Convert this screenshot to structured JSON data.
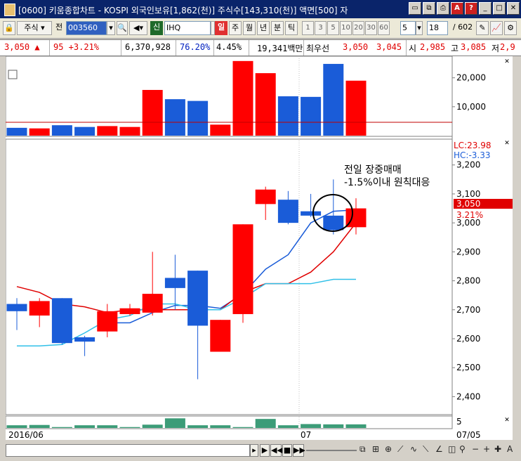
{
  "window": {
    "title": "[0600] 키움종합차트 - KOSPI 외국인보유[1,862(천)] 주식수[143,310(천)] 액면[500] 자",
    "icons": [
      "minimize-icon",
      "maximize-icon",
      "close-icon"
    ]
  },
  "toolbar": {
    "market_select": "주식",
    "code_prefix": "전",
    "stock_code": "003560",
    "stock_name": "IHQ",
    "credit_label": "신",
    "periods": [
      "일",
      "주",
      "월",
      "년",
      "분",
      "틱"
    ],
    "active_period": "일",
    "minute_options": [
      "1",
      "3",
      "5",
      "10",
      "20",
      "30",
      "60"
    ],
    "count_value": "5",
    "page_value": "18",
    "page_total": "/ 602"
  },
  "quote": {
    "price": "3,050 ▲",
    "change": "95 +3.21%",
    "volume": "6,370,928",
    "ratio": "76.20%",
    "turnover": "4.45%",
    "amount": "19,341백만",
    "best_label": "최우선",
    "ask": "3,050",
    "bid": "3,045",
    "open_label": "시",
    "open": "2,985",
    "high_label": "고",
    "high": "3,085",
    "low_label": "저",
    "low": "2,9"
  },
  "annotation": {
    "line1": "전일 장중매매",
    "line2": "-1.5%이내 원칙대응"
  },
  "indicators": {
    "lc": "LC:23.98",
    "hc": "HC:-3.33",
    "last_price": "3,050",
    "last_pct": "3.21%"
  },
  "colors": {
    "up": "#ff0000",
    "down": "#1a5cd8",
    "ma1": "#1a5cd8",
    "ma2": "#e00000",
    "ma3": "#30c0e8",
    "vol_green": "#3c9c78"
  },
  "chart_data": [
    {
      "type": "bar",
      "title": "",
      "y_ticks": [
        "10,000",
        "20,000"
      ],
      "ylim": [
        0,
        26000
      ],
      "values": [
        2700,
        2500,
        3600,
        3000,
        3300,
        3000,
        15800,
        12600,
        12000,
        3800,
        25800,
        21600,
        13600,
        13400,
        24800,
        19000
      ],
      "colors": [
        "down",
        "up",
        "down",
        "down",
        "up",
        "up",
        "up",
        "down",
        "down",
        "up",
        "up",
        "up",
        "down",
        "down",
        "down",
        "up"
      ]
    },
    {
      "type": "candlestick",
      "y_ticks": [
        "2,400",
        "2,500",
        "2,600",
        "2,700",
        "2,800",
        "2,900",
        "3,000",
        "3,100",
        "3,200"
      ],
      "ylim": [
        2350,
        3260
      ],
      "x_labels": [
        "2016/06",
        "07",
        "07/05"
      ],
      "candles": [
        {
          "o": 2720,
          "h": 2740,
          "l": 2630,
          "c": 2695
        },
        {
          "o": 2680,
          "h": 2740,
          "l": 2640,
          "c": 2730
        },
        {
          "o": 2740,
          "h": 2740,
          "l": 2580,
          "c": 2585
        },
        {
          "o": 2605,
          "h": 2610,
          "l": 2540,
          "c": 2590
        },
        {
          "o": 2625,
          "h": 2720,
          "l": 2605,
          "c": 2695
        },
        {
          "o": 2685,
          "h": 2720,
          "l": 2680,
          "c": 2705
        },
        {
          "o": 2690,
          "h": 2900,
          "l": 2680,
          "c": 2755
        },
        {
          "o": 2810,
          "h": 2890,
          "l": 2700,
          "c": 2775
        },
        {
          "o": 2835,
          "h": 2835,
          "l": 2460,
          "c": 2645
        },
        {
          "o": 2555,
          "h": 2665,
          "l": 2555,
          "c": 2665
        },
        {
          "o": 2685,
          "h": 2995,
          "l": 2655,
          "c": 2995
        },
        {
          "o": 3065,
          "h": 3125,
          "l": 3010,
          "c": 3115
        },
        {
          "o": 3080,
          "h": 3110,
          "l": 2995,
          "c": 3000
        },
        {
          "o": 3040,
          "h": 3100,
          "l": 3020,
          "c": 3025
        },
        {
          "o": 3025,
          "h": 3150,
          "l": 2960,
          "c": 2975
        },
        {
          "o": 2985,
          "h": 3085,
          "l": 2960,
          "c": 3050
        }
      ],
      "series": [
        {
          "name": "",
          "color": "ma1",
          "values": [
            null,
            null,
            null,
            null,
            2655,
            2655,
            2690,
            2715,
            2715,
            2705,
            2755,
            2840,
            2890,
            3000,
            3040,
            3045
          ]
        },
        {
          "name": "",
          "color": "ma2",
          "values": [
            2780,
            2760,
            2720,
            2710,
            2690,
            2700,
            2700,
            2700,
            2700,
            2700,
            2760,
            2790,
            2790,
            2830,
            2900,
            3000
          ]
        },
        {
          "name": "",
          "color": "ma3",
          "values": [
            2575,
            2575,
            2580,
            2620,
            2665,
            2680,
            2720,
            2720,
            2700,
            2700,
            2740,
            2790,
            2790,
            2790,
            2805,
            2805
          ]
        }
      ],
      "volume_values": [
        900,
        1000,
        300,
        900,
        900,
        300,
        1100,
        3200,
        900,
        900,
        300,
        3000,
        900,
        1300,
        1200,
        1200
      ]
    }
  ]
}
